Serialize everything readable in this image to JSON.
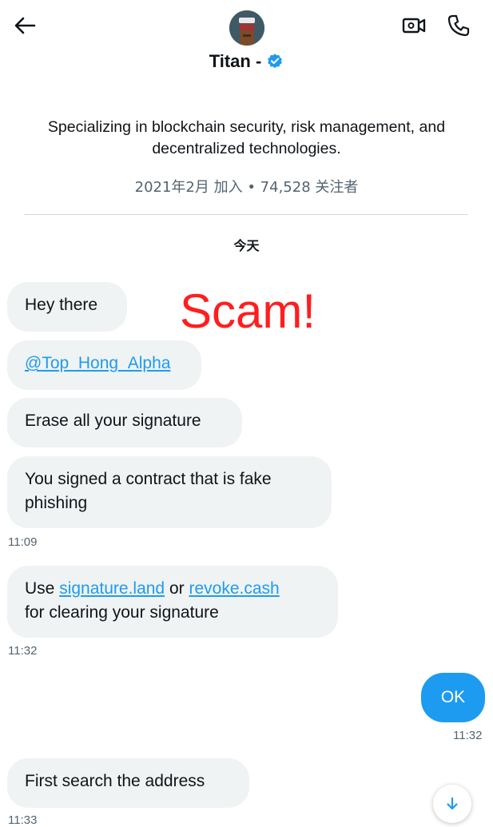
{
  "header": {
    "name": "Titan -",
    "bio": "Specializing in blockchain security, risk management, and decentralized technologies.",
    "joined": "2021年2月 加入 • 74,528 关注者",
    "verified_color": "#1d9bf0"
  },
  "icons": {
    "back": "back-arrow-icon",
    "video": "video-call-icon",
    "phone": "phone-icon",
    "verified": "verified-badge-icon",
    "scroll": "scroll-down-icon"
  },
  "day_label": "今天",
  "overlay": {
    "text": "Scam!",
    "color": "#ff1e1e"
  },
  "messages": {
    "m1": "Hey there",
    "m2": "@Top_Hong_Alpha",
    "m3": "Erase all your signature",
    "m4": "You signed a contract that is fake phishing",
    "t1": "11:09",
    "m5_a": "Use ",
    "m5_link1": "signature.land",
    "m5_b": " or ",
    "m5_link2": "revoke.cash",
    "m5_c": "for clearing your signature",
    "t2": "11:32",
    "out1": "OK",
    "t3": "11:32",
    "m6": "First search the address",
    "t4": "11:33"
  },
  "colors": {
    "incoming_bubble": "#eff3f4",
    "outgoing_bubble": "#1d9bf0",
    "link": "#1d9bf0"
  }
}
